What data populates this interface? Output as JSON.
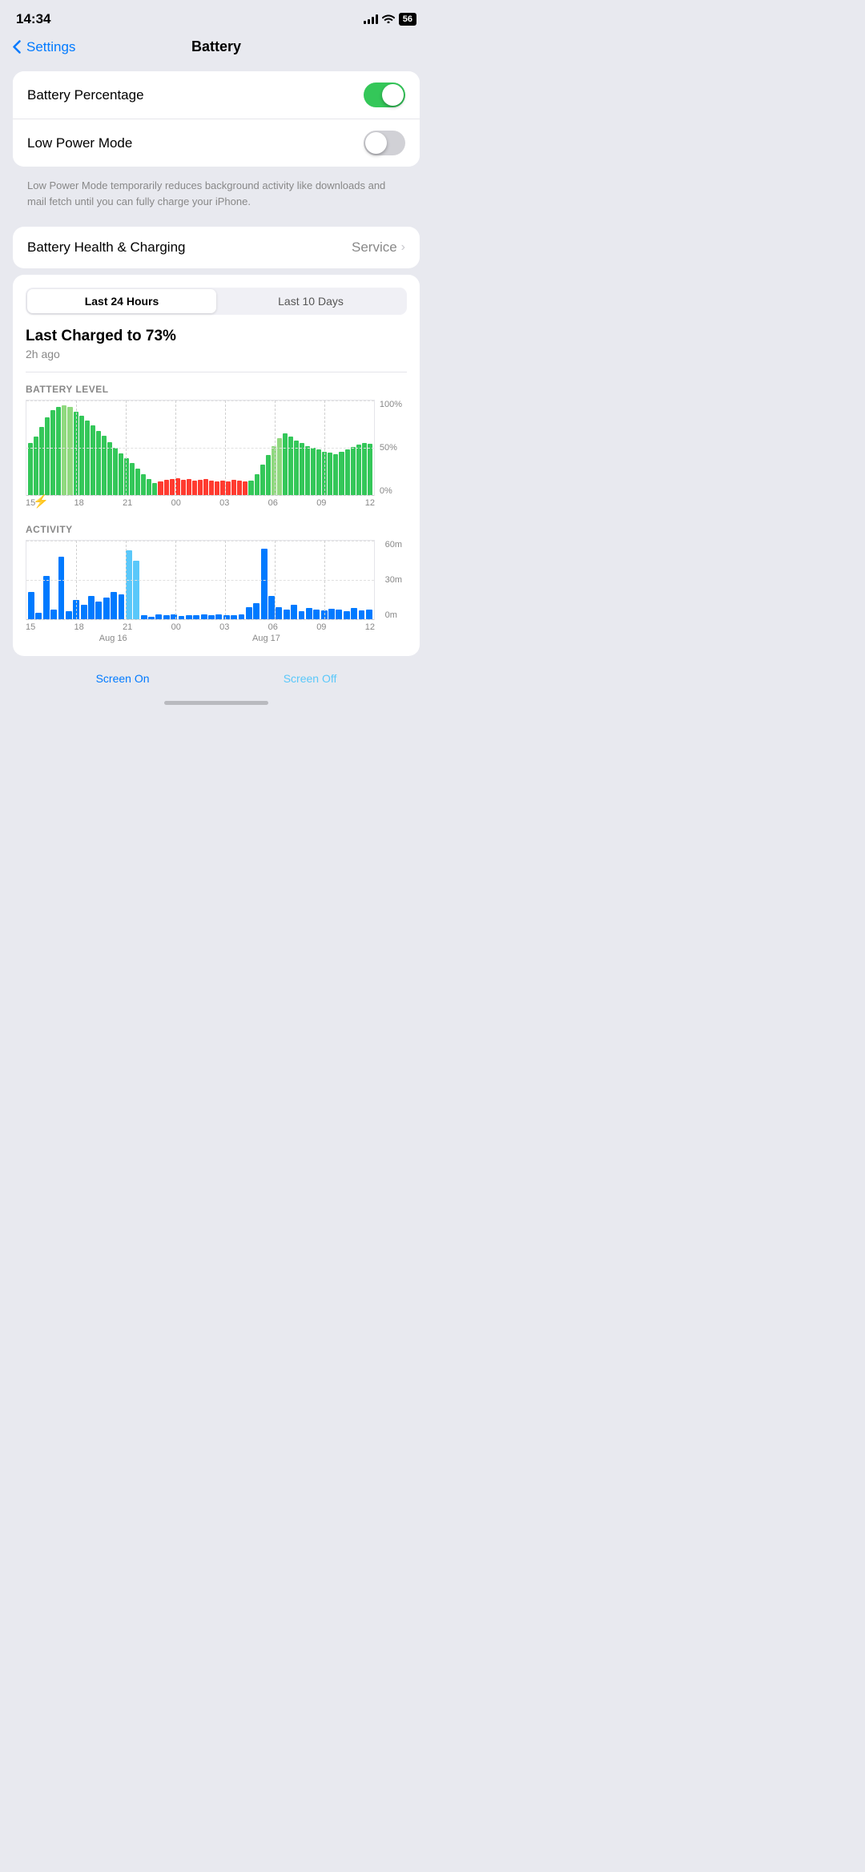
{
  "statusBar": {
    "time": "14:34",
    "battery": "56"
  },
  "nav": {
    "backLabel": "Settings",
    "title": "Battery"
  },
  "settings": {
    "batteryPercentageLabel": "Battery Percentage",
    "batteryPercentageOn": true,
    "lowPowerModeLabel": "Low Power Mode",
    "lowPowerModeOn": false,
    "lowPowerDescription": "Low Power Mode temporarily reduces background activity like downloads and mail fetch until you can fully charge your iPhone.",
    "batteryHealthLabel": "Battery Health & Charging",
    "serviceLabel": "Service"
  },
  "chart": {
    "tab1": "Last 24 Hours",
    "tab2": "Last 10 Days",
    "lastChargedTitle": "Last Charged to 73%",
    "lastChargedSub": "2h ago",
    "batteryLevelLabel": "BATTERY LEVEL",
    "activityLabel": "ACTIVITY",
    "batteryYLabels": [
      "100%",
      "50%",
      "0%"
    ],
    "batteryXLabels": [
      "15",
      "18",
      "21",
      "00",
      "03",
      "06",
      "09",
      "12"
    ],
    "activityYLabels": [
      "60m",
      "30m",
      "0m"
    ],
    "activityXLabels": [
      "15",
      "18",
      "21",
      "00",
      "03",
      "06",
      "09",
      "12"
    ],
    "dateLabels": [
      "Aug 16",
      "Aug 17"
    ],
    "screenOnLabel": "Screen On",
    "screenOffLabel": "Screen Off"
  }
}
